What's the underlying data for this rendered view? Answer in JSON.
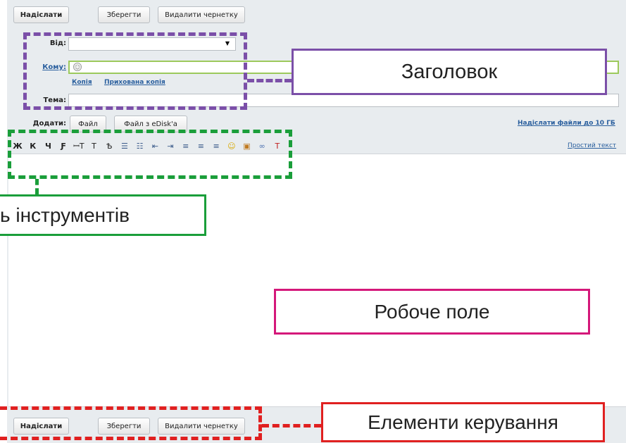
{
  "top_buttons": {
    "send": "Надіслати",
    "save": "Зберегти",
    "delete_draft": "Видалити чернетку"
  },
  "header": {
    "from_label": "Від:",
    "to_label": "Кому:",
    "cc_link": "Копія",
    "bcc_link": "Прихована копія",
    "subject_label": "Тема:"
  },
  "attach": {
    "label": "Додати:",
    "file_button": "Файл",
    "edisk_button": "Файл з eDisk'a",
    "big_files_link": "Надіслати файли до 10 ГБ"
  },
  "toolbar": {
    "items": [
      {
        "glyph": "Ж",
        "icon": "bold-icon"
      },
      {
        "glyph": "К",
        "icon": "italic-icon"
      },
      {
        "glyph": "Ч",
        "icon": "underline-icon"
      },
      {
        "glyph": "Ƒ",
        "icon": "font-icon"
      },
      {
        "glyph": "ꟷT",
        "icon": "font-size-icon"
      },
      {
        "glyph": "T",
        "icon": "text-color-icon"
      },
      {
        "glyph": "Ѣ",
        "icon": "background-color-icon"
      },
      {
        "glyph": "☰",
        "icon": "numbered-list-icon"
      },
      {
        "glyph": "☷",
        "icon": "bulleted-list-icon"
      },
      {
        "glyph": "⇤",
        "icon": "outdent-icon"
      },
      {
        "glyph": "⇥",
        "icon": "indent-icon"
      },
      {
        "glyph": "≡",
        "icon": "align-left-icon"
      },
      {
        "glyph": "≡",
        "icon": "align-center-icon"
      },
      {
        "glyph": "≡",
        "icon": "align-right-icon"
      },
      {
        "glyph": "☺",
        "icon": "smiley-icon"
      },
      {
        "glyph": "▣",
        "icon": "image-icon"
      },
      {
        "glyph": "∞",
        "icon": "link-icon"
      },
      {
        "glyph": "T",
        "icon": "clear-format-icon"
      }
    ],
    "plain_text_link": "Простий текст"
  },
  "callouts": {
    "header": "Заголовок",
    "toolbar": "ь інструментів",
    "workspace": "Робоче поле",
    "controls": "Елементи керування"
  },
  "colors": {
    "header_callout": "#7b4fa8",
    "toolbar_callout": "#1a9e3a",
    "workspace_callout": "#d4187a",
    "controls_callout": "#e02020",
    "recipient_field_border": "#9cc95c"
  }
}
